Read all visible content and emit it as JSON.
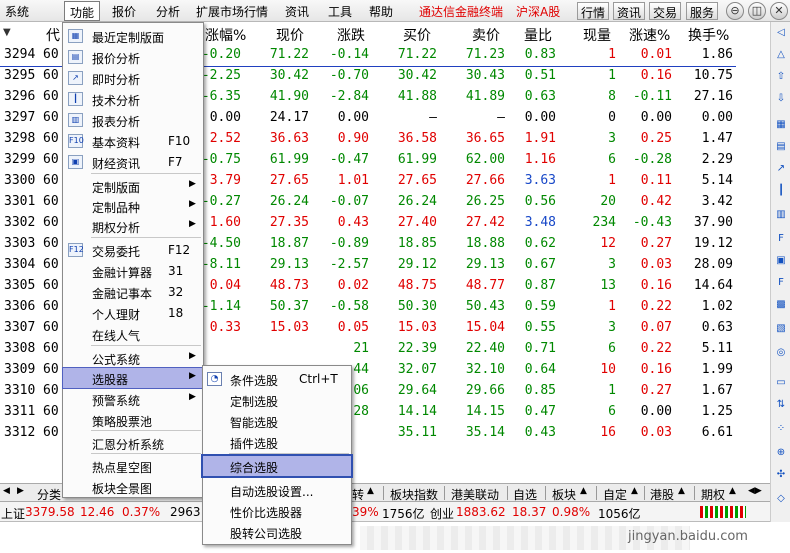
{
  "menubar": {
    "items": [
      "系统",
      "功能",
      "报价",
      "分析",
      "扩展市场行情",
      "资讯",
      "工具",
      "帮助"
    ],
    "brand": "通达信金融终端",
    "market": "沪深A股",
    "buttons": [
      "行情",
      "资讯",
      "交易",
      "服务"
    ]
  },
  "table": {
    "columns": [
      "代",
      "涨幅%",
      "现价",
      "涨跌",
      "买价",
      "卖价",
      "量比",
      "现量",
      "涨速%",
      "换手%"
    ],
    "rows": [
      {
        "idx": "3294",
        "code": "60",
        "chg_pct": "-0.20",
        "price": "71.22",
        "chg": "-0.14",
        "bid": "71.22",
        "ask": "71.23",
        "vol_ratio": "0.83",
        "cur_vol": "1",
        "speed": "0.01",
        "turnover": "1.86"
      },
      {
        "idx": "3295",
        "code": "60",
        "chg_pct": "-2.25",
        "price": "30.42",
        "chg": "-0.70",
        "bid": "30.42",
        "ask": "30.43",
        "vol_ratio": "0.51",
        "cur_vol": "1",
        "speed": "0.16",
        "turnover": "10.75"
      },
      {
        "idx": "3296",
        "code": "60",
        "chg_pct": "-6.35",
        "price": "41.90",
        "chg": "-2.84",
        "bid": "41.88",
        "ask": "41.89",
        "vol_ratio": "0.63",
        "cur_vol": "8",
        "speed": "-0.11",
        "turnover": "27.16"
      },
      {
        "idx": "3297",
        "code": "60",
        "chg_pct": "0.00",
        "price": "24.17",
        "chg": "0.00",
        "bid": "—",
        "ask": "—",
        "vol_ratio": "0.00",
        "cur_vol": "0",
        "speed": "0.00",
        "turnover": "0.00"
      },
      {
        "idx": "3298",
        "code": "60",
        "chg_pct": "2.52",
        "price": "36.63",
        "chg": "0.90",
        "bid": "36.58",
        "ask": "36.65",
        "vol_ratio": "1.91",
        "cur_vol": "3",
        "speed": "0.25",
        "turnover": "1.47"
      },
      {
        "idx": "3299",
        "code": "60",
        "chg_pct": "-0.75",
        "price": "61.99",
        "chg": "-0.47",
        "bid": "61.99",
        "ask": "62.00",
        "vol_ratio": "1.16",
        "cur_vol": "6",
        "speed": "-0.28",
        "turnover": "2.29"
      },
      {
        "idx": "3300",
        "code": "60",
        "chg_pct": "3.79",
        "price": "27.65",
        "chg": "1.01",
        "bid": "27.65",
        "ask": "27.66",
        "vol_ratio": "3.63",
        "cur_vol": "1",
        "speed": "0.11",
        "turnover": "5.14"
      },
      {
        "idx": "3301",
        "code": "60",
        "chg_pct": "-0.27",
        "price": "26.24",
        "chg": "-0.07",
        "bid": "26.24",
        "ask": "26.25",
        "vol_ratio": "0.56",
        "cur_vol": "20",
        "speed": "0.42",
        "turnover": "3.42"
      },
      {
        "idx": "3302",
        "code": "60",
        "chg_pct": "1.60",
        "price": "27.35",
        "chg": "0.43",
        "bid": "27.40",
        "ask": "27.42",
        "vol_ratio": "3.48",
        "cur_vol": "234",
        "speed": "-0.43",
        "turnover": "37.90"
      },
      {
        "idx": "3303",
        "code": "60",
        "chg_pct": "-4.50",
        "price": "18.87",
        "chg": "-0.89",
        "bid": "18.85",
        "ask": "18.88",
        "vol_ratio": "0.62",
        "cur_vol": "12",
        "speed": "0.27",
        "turnover": "19.12"
      },
      {
        "idx": "3304",
        "code": "60",
        "chg_pct": "-8.11",
        "price": "29.13",
        "chg": "-2.57",
        "bid": "29.12",
        "ask": "29.13",
        "vol_ratio": "0.67",
        "cur_vol": "3",
        "speed": "0.03",
        "turnover": "28.09"
      },
      {
        "idx": "3305",
        "code": "60",
        "chg_pct": "0.04",
        "price": "48.73",
        "chg": "0.02",
        "bid": "48.75",
        "ask": "48.77",
        "vol_ratio": "0.87",
        "cur_vol": "13",
        "speed": "0.16",
        "turnover": "14.64"
      },
      {
        "idx": "3306",
        "code": "60",
        "chg_pct": "-1.14",
        "price": "50.37",
        "chg": "-0.58",
        "bid": "50.30",
        "ask": "50.43",
        "vol_ratio": "0.59",
        "cur_vol": "1",
        "speed": "0.22",
        "turnover": "1.02"
      },
      {
        "idx": "3307",
        "code": "60",
        "chg_pct": "0.33",
        "price": "15.03",
        "chg": "0.05",
        "bid": "15.03",
        "ask": "15.04",
        "vol_ratio": "0.55",
        "cur_vol": "3",
        "speed": "0.07",
        "turnover": "0.63"
      },
      {
        "idx": "3308",
        "code": "60",
        "chg_pct": "",
        "price": "",
        "chg": "",
        "bid": "22.39",
        "ask": "22.40",
        "vol_ratio": "0.71",
        "cur_vol": "6",
        "speed": "0.22",
        "turnover": "5.11"
      },
      {
        "idx": "3309",
        "code": "60",
        "chg_pct": "",
        "price": "",
        "chg": "",
        "bid": "32.07",
        "ask": "32.10",
        "vol_ratio": "0.64",
        "cur_vol": "10",
        "speed": "0.16",
        "turnover": "1.99"
      },
      {
        "idx": "3310",
        "code": "60",
        "chg_pct": "",
        "price": "",
        "chg": "",
        "bid": "29.64",
        "ask": "29.66",
        "vol_ratio": "0.85",
        "cur_vol": "1",
        "speed": "0.27",
        "turnover": "1.67"
      },
      {
        "idx": "3311",
        "code": "60",
        "chg_pct": "",
        "price": "",
        "chg": "",
        "bid": "14.14",
        "ask": "14.15",
        "vol_ratio": "0.47",
        "cur_vol": "6",
        "speed": "0.00",
        "turnover": "1.25"
      },
      {
        "idx": "3312",
        "code": "60",
        "chg_pct": "",
        "price": "",
        "chg": "",
        "bid": "35.11",
        "ask": "35.14",
        "vol_ratio": "0.43",
        "cur_vol": "16",
        "speed": "0.03",
        "turnover": "6.61"
      }
    ],
    "partial": {
      "r14c": "21",
      "r15c": "44",
      "r16c": "06",
      "r17c": "28"
    }
  },
  "tabs": [
    "分类",
    "转",
    "板块指数",
    "港美联动",
    "自选",
    "板块",
    "自定",
    "港股",
    "期权"
  ],
  "status": {
    "sh_label": "上证",
    "sh_index": "3379.58",
    "sh_chg": "12.46",
    "sh_pct": "0.37%",
    "sh_amt": "2963",
    "mid_pct": "39%",
    "mid_amt": "1756亿",
    "cy_label": "创业",
    "cy_index": "1883.62",
    "cy_chg": "18.37",
    "cy_pct": "0.98%",
    "cy_amt": "1056亿"
  },
  "watermark": "jingyan.baidu.com",
  "menu_function": {
    "items": [
      {
        "label": "最近定制版面",
        "shortcut": "",
        "icon": "layout-icon",
        "arrow": false
      },
      {
        "label": "报价分析",
        "shortcut": "",
        "icon": "table-icon",
        "arrow": false
      },
      {
        "label": "即时分析",
        "shortcut": "",
        "icon": "line-chart-icon",
        "arrow": false
      },
      {
        "label": "技术分析",
        "shortcut": "",
        "icon": "candle-icon",
        "arrow": false
      },
      {
        "label": "报表分析",
        "shortcut": "",
        "icon": "report-icon",
        "arrow": false
      },
      {
        "label": "基本资料",
        "shortcut": "F10",
        "icon": "f10-icon",
        "arrow": false
      },
      {
        "label": "财经资讯",
        "shortcut": "F7",
        "icon": "news-icon",
        "arrow": false
      },
      {
        "label": "定制版面",
        "shortcut": "",
        "icon": "",
        "arrow": true
      },
      {
        "label": "定制品种",
        "shortcut": "",
        "icon": "",
        "arrow": true
      },
      {
        "label": "期权分析",
        "shortcut": "",
        "icon": "",
        "arrow": true
      },
      {
        "label": "交易委托",
        "shortcut": "F12",
        "icon": "f12-icon",
        "arrow": false
      },
      {
        "label": "金融计算器",
        "shortcut": "31",
        "icon": "",
        "arrow": false
      },
      {
        "label": "金融记事本",
        "shortcut": "32",
        "icon": "",
        "arrow": false
      },
      {
        "label": "个人理财",
        "shortcut": "18",
        "icon": "",
        "arrow": false
      },
      {
        "label": "在线人气",
        "shortcut": "",
        "icon": "",
        "arrow": false
      },
      {
        "label": "公式系统",
        "shortcut": "",
        "icon": "",
        "arrow": true
      },
      {
        "label": "选股器",
        "shortcut": "",
        "icon": "",
        "arrow": true
      },
      {
        "label": "预警系统",
        "shortcut": "",
        "icon": "",
        "arrow": true
      },
      {
        "label": "策略股票池",
        "shortcut": "",
        "icon": "",
        "arrow": false
      },
      {
        "label": "汇恩分析系统",
        "shortcut": "",
        "icon": "",
        "arrow": false
      },
      {
        "label": "热点星空图",
        "shortcut": "",
        "icon": "",
        "arrow": false
      },
      {
        "label": "板块全景图",
        "shortcut": "",
        "icon": "",
        "arrow": false
      }
    ]
  },
  "menu_picker": {
    "items": [
      {
        "label": "条件选股",
        "shortcut": "Ctrl+T"
      },
      {
        "label": "定制选股",
        "shortcut": ""
      },
      {
        "label": "智能选股",
        "shortcut": ""
      },
      {
        "label": "插件选股",
        "shortcut": ""
      },
      {
        "label": "综合选股",
        "shortcut": ""
      },
      {
        "label": "自动选股设置...",
        "shortcut": ""
      },
      {
        "label": "性价比选股器",
        "shortcut": ""
      },
      {
        "label": "股转公司选股",
        "shortcut": ""
      }
    ]
  },
  "colors": {
    "up": "#e00000",
    "down": "#008800",
    "flat": "#000000",
    "blue": "#1848c8",
    "brand": "#e00000"
  }
}
